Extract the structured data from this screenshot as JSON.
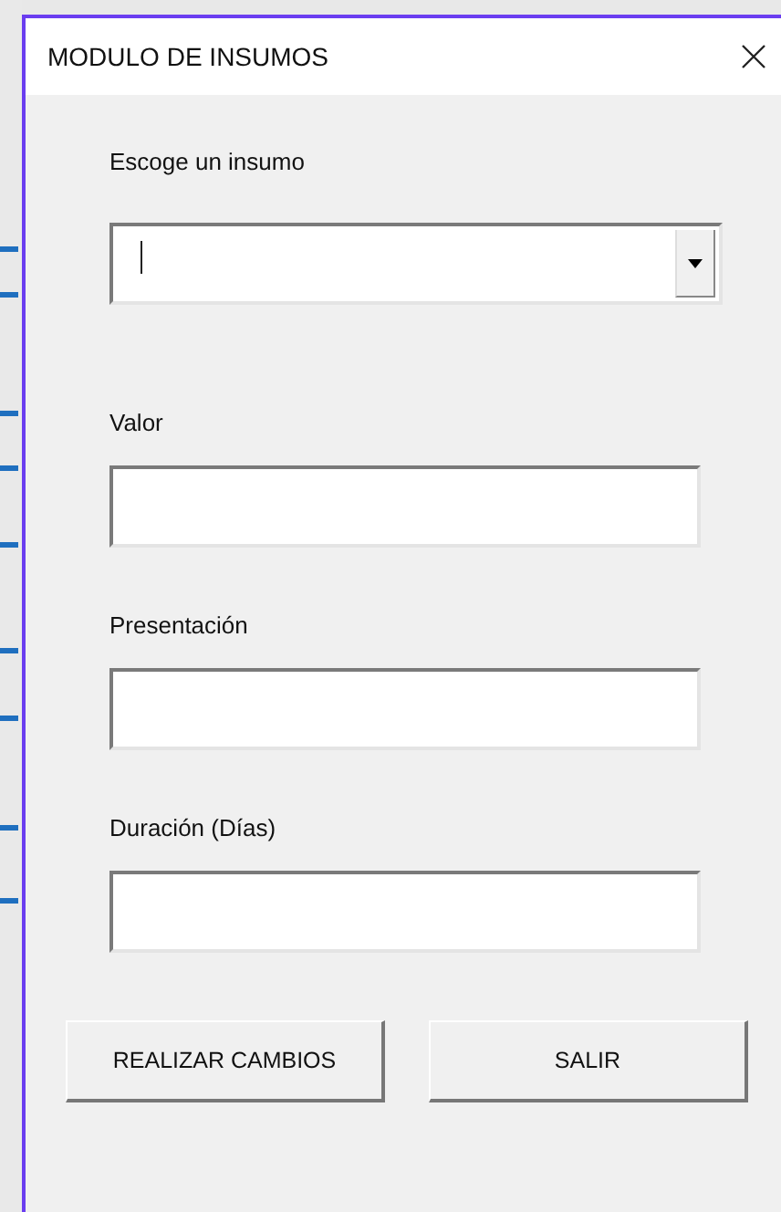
{
  "window": {
    "title": "MODULO DE INSUMOS"
  },
  "fields": [
    {
      "label": "Escoge un insumo",
      "kind": "combo",
      "focused": true
    },
    {
      "label": "Valor",
      "kind": "text",
      "focused": false
    },
    {
      "label": "Presentación",
      "kind": "text",
      "focused": false
    },
    {
      "label": "Duración (Días)",
      "kind": "text",
      "focused": false
    }
  ],
  "buttons": [
    "REALIZAR CAMBIOS",
    "SALIR"
  ]
}
